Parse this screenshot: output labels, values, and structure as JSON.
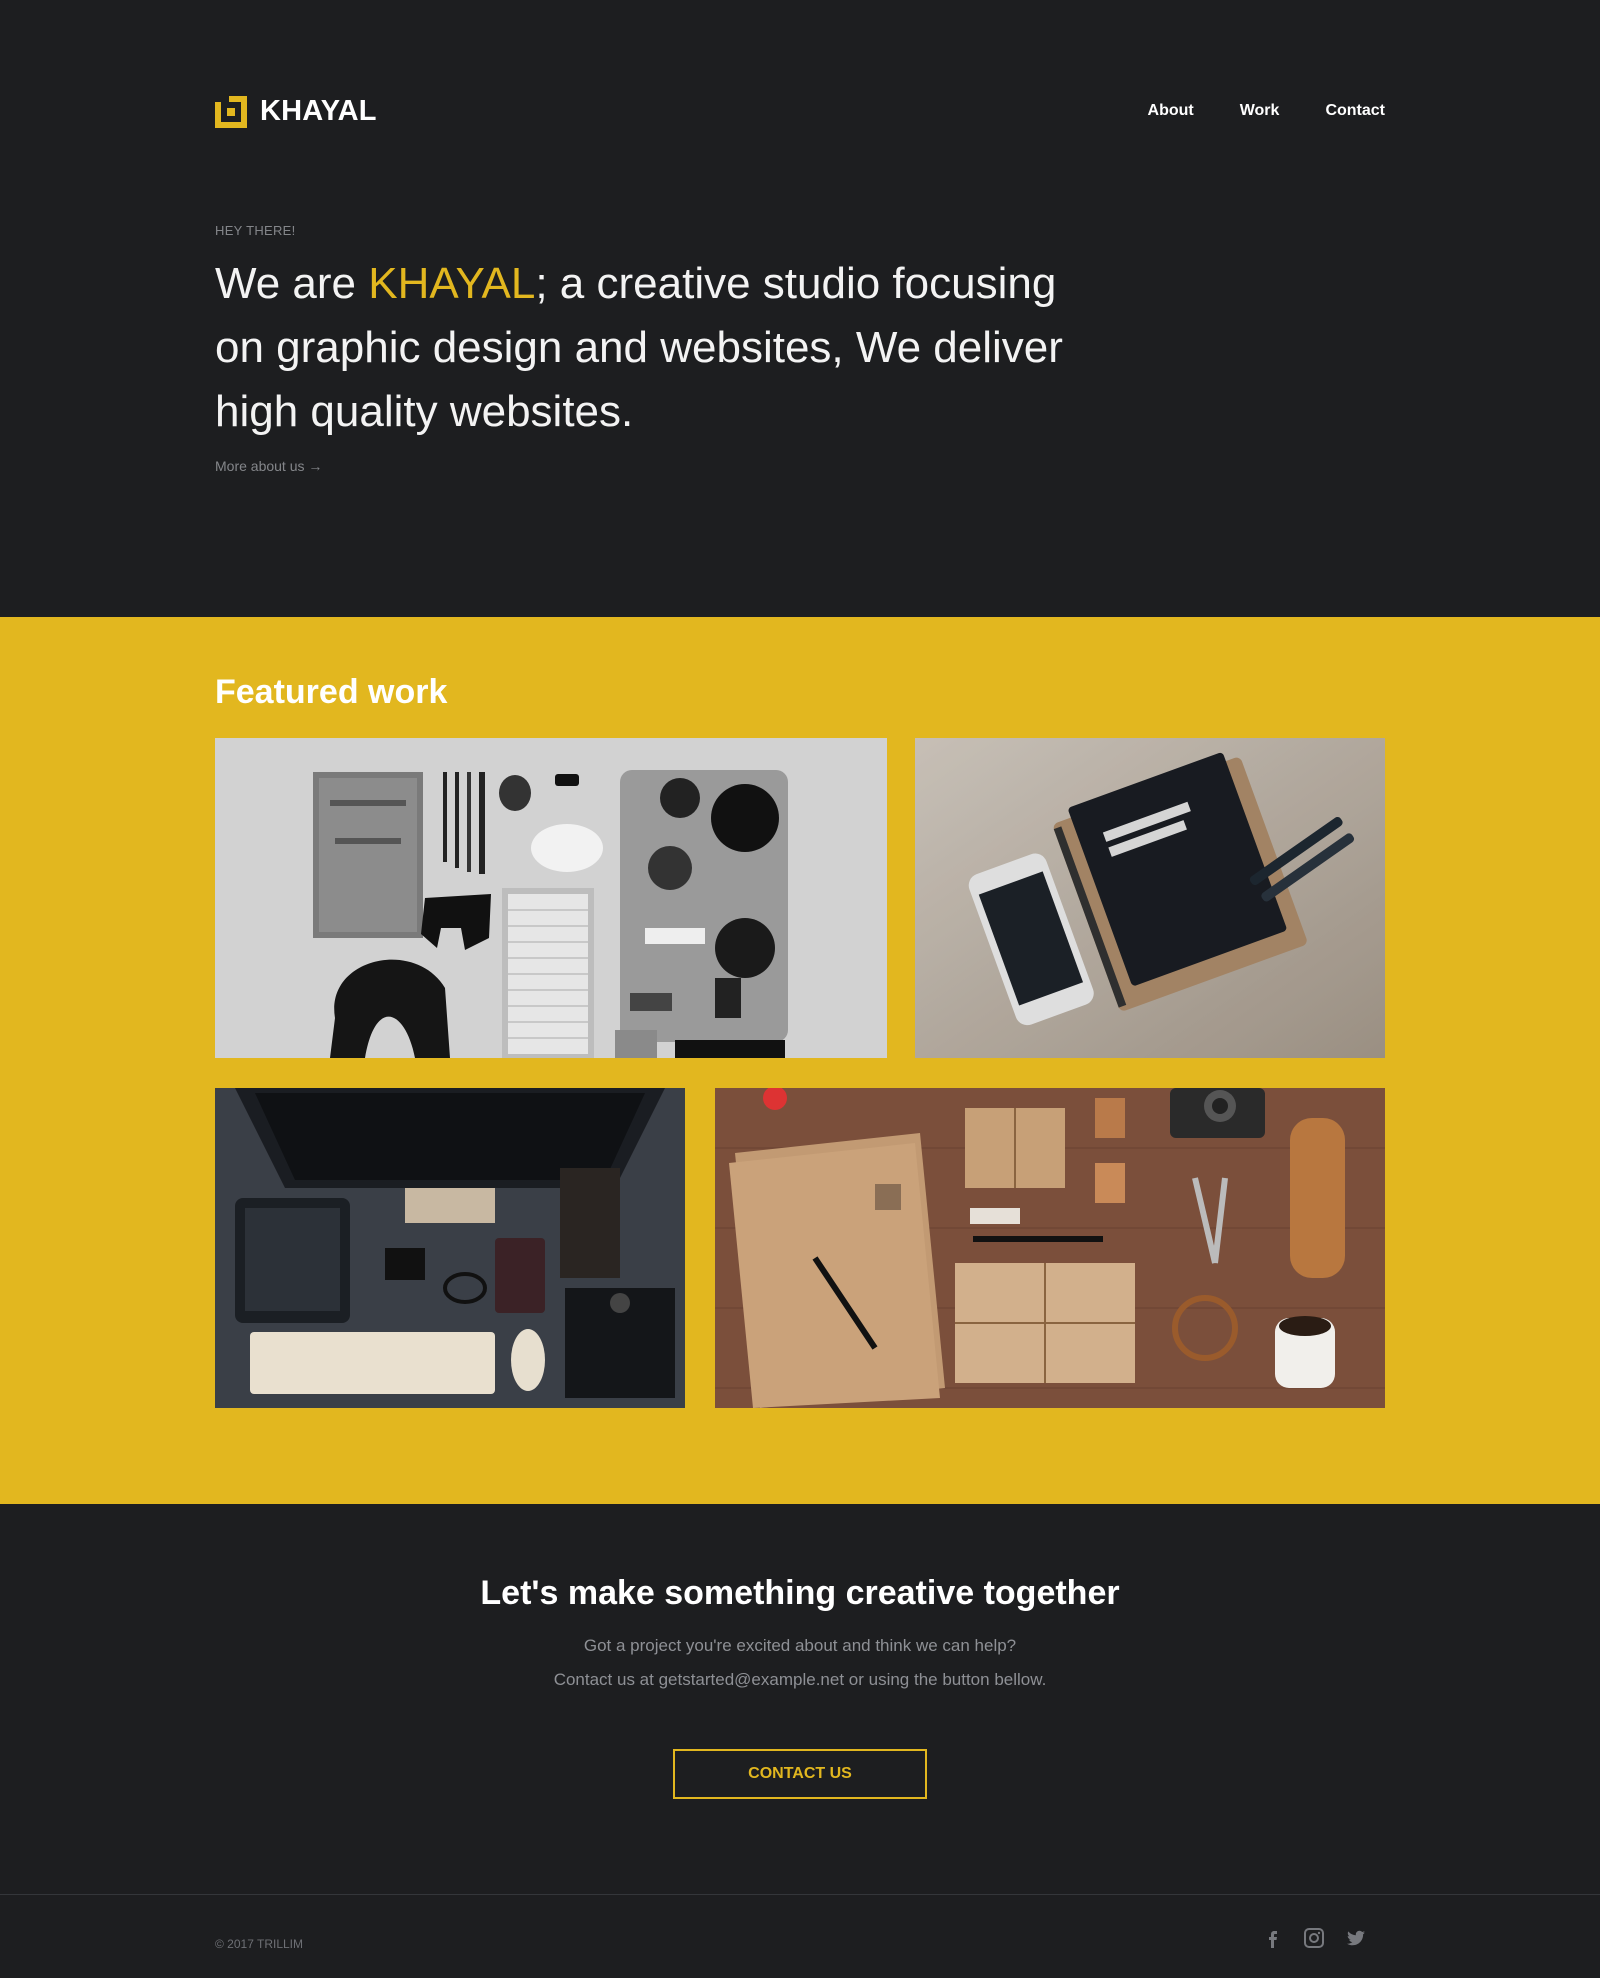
{
  "header": {
    "logo_text": "KHAYAL",
    "nav": [
      {
        "label": "About"
      },
      {
        "label": "Work"
      },
      {
        "label": "Contact"
      }
    ]
  },
  "hero": {
    "eyebrow": "HEY THERE!",
    "headline_prefix": "We are ",
    "headline_brand": "KHAYAL",
    "headline_suffix": ";  a creative studio focusing on graphic design and websites, We deliver high quality websites.",
    "more_link": "More about us →"
  },
  "featured": {
    "title": "Featured work",
    "items": [
      {
        "name": "desk-flatlay-grayscale",
        "icon": "workspace-grayscale-photo"
      },
      {
        "name": "field-notes-phone",
        "icon": "notebook-phone-photo"
      },
      {
        "name": "desktop-workstation",
        "icon": "computer-setup-photo"
      },
      {
        "name": "kraft-stationery",
        "icon": "stationery-photo"
      }
    ]
  },
  "cta": {
    "title": "Let's make something creative together",
    "line1": "Got a project you're excited about and think we can help?",
    "line2": "Contact us at getstarted@example.net or using the button bellow.",
    "button": "CONTACT US"
  },
  "footer": {
    "copyright": "© 2017 TRILLIM",
    "social": [
      "facebook-icon",
      "instagram-icon",
      "twitter-icon"
    ]
  },
  "colors": {
    "background": "#1d1e20",
    "accent": "#e2b71f",
    "muted_text": "#84868a"
  }
}
